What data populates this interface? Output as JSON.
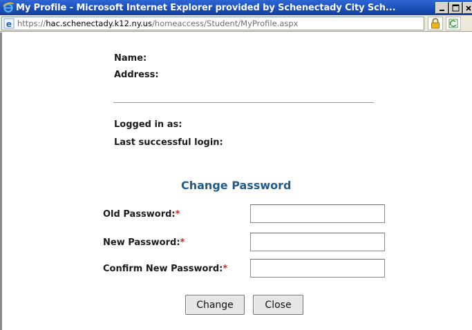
{
  "window": {
    "title": "My Profile - Microsoft Internet Explorer provided by Schenectady City Sch...",
    "buttons": [
      "minimize",
      "maximize",
      "close"
    ]
  },
  "addressbar": {
    "url_scheme": "https://",
    "url_host": "hac.schenectady.k12.ny.us",
    "url_path": "/homeaccess/Student/MyProfile.aspx"
  },
  "profile": {
    "name_label": "Name:",
    "address_label": "Address:",
    "logged_in_label": "Logged in as:",
    "last_login_label": "Last successful login:"
  },
  "change_password": {
    "heading": "Change Password",
    "required_marker": "*",
    "fields": [
      {
        "label": "Old Password:",
        "value": ""
      },
      {
        "label": "New Password:",
        "value": ""
      },
      {
        "label": "Confirm New Password:",
        "value": ""
      }
    ],
    "change_label": "Change",
    "close_label": "Close"
  },
  "colors": {
    "titlebar": "#1b4fb8",
    "heading": "#1f5a8c",
    "required": "#d42020"
  }
}
